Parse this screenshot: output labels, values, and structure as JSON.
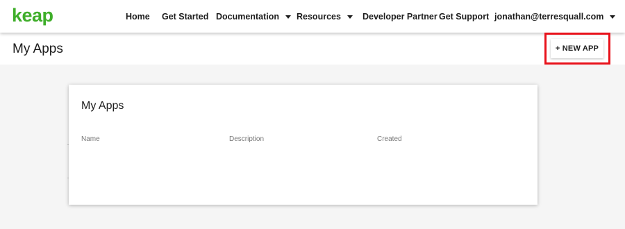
{
  "brand": {
    "logo_text": "keap",
    "logo_color": "#3fae2a"
  },
  "nav": {
    "items": [
      {
        "label": "Home",
        "has_caret": false
      },
      {
        "label": "Get Started",
        "has_caret": false
      },
      {
        "label": "Documentation",
        "has_caret": true
      },
      {
        "label": "Resources",
        "has_caret": true
      },
      {
        "label": "Developer Partner",
        "has_caret": false
      },
      {
        "label": "Get Support",
        "has_caret": false
      }
    ],
    "user": {
      "label": "jonathan@terresquall.com",
      "has_caret": true
    }
  },
  "page": {
    "title": "My Apps"
  },
  "actions": {
    "new_app_label": "+ NEW APP",
    "highlight_color": "#e8111a"
  },
  "apps_card": {
    "title": "My Apps",
    "columns": [
      "Name",
      "Description",
      "Created"
    ],
    "rows": []
  }
}
